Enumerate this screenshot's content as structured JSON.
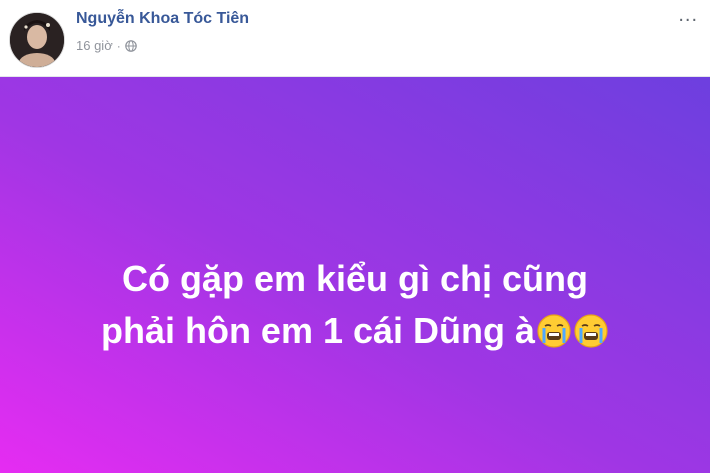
{
  "post": {
    "author": "Nguyễn Khoa Tóc Tiên",
    "time": "16 giờ",
    "separator": "·",
    "privacy_icon": "globe-icon",
    "more_icon": "more-options-icon",
    "more_label": "...",
    "text_line1": "Có gặp em kiểu gì chị cũng",
    "text_line2": "phải hôn em 1 cái Dũng à",
    "emoji": "crying-face-icon",
    "emoji_count": 2
  },
  "colors": {
    "author": "#385898",
    "gradient_start": "#e62cf2",
    "gradient_end": "#6d3fdf",
    "text": "#ffffff"
  }
}
